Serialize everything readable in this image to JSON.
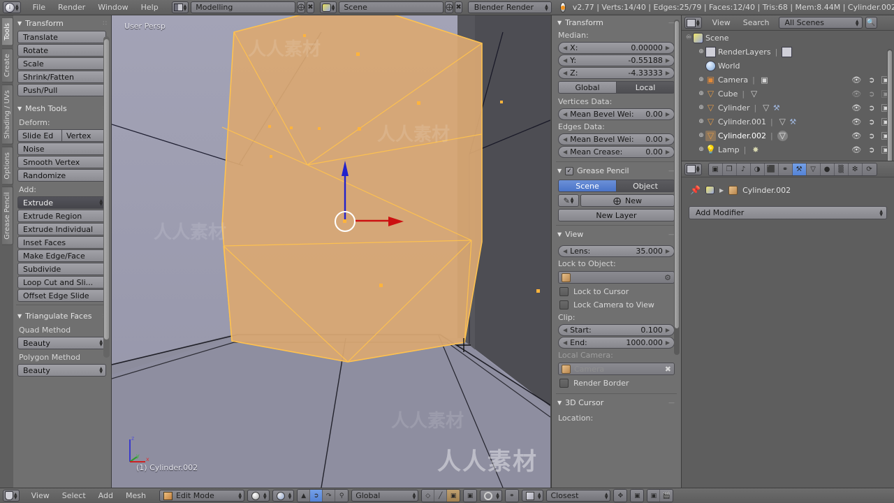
{
  "app": {
    "version": "v2.77",
    "engine": "Blender Render",
    "screen_layout": "Modelling",
    "scene_name": "Scene",
    "stats": "v2.77 | Verts:14/40 | Edges:25/79 | Faces:12/40 | Tris:68 | Mem:8.44M | Cylinder.002"
  },
  "topbar": {
    "menus": [
      "File",
      "Render",
      "Window",
      "Help"
    ],
    "layout_field": "Modelling",
    "scene_field": "Scene",
    "engine_field": "Blender Render",
    "icons": {
      "blender": "blender-icon",
      "layout": "screen-layout-icon",
      "scene": "scene-icon",
      "add": "plus-icon",
      "remove": "x-icon",
      "render_engine": "render-engine-icon"
    }
  },
  "viewport": {
    "view_label": "User Persp",
    "object_label": "(1) Cylinder.002",
    "axis": {
      "x": "x",
      "y": "y",
      "z": "z"
    },
    "watermark": "人人素材",
    "colors": {
      "bg_left": "#9a9aae",
      "bg_right": "#4f4f55",
      "floor": "#8c8c9c",
      "mesh_face": "#d9a873",
      "mesh_edge": "#ffc04d",
      "gizmo_z": "#2020dd",
      "gizmo_x": "#cc1111"
    }
  },
  "toolshelf": {
    "tabs": [
      "Tools",
      "Create",
      "Shading / UVs",
      "Options",
      "Grease Pencil"
    ],
    "active_tab": "Tools",
    "panels": [
      {
        "title": "Transform",
        "buttons": [
          "Translate",
          "Rotate",
          "Scale",
          "Shrink/Fatten",
          "Push/Pull"
        ]
      },
      {
        "title": "Mesh Tools",
        "deform_label": "Deform:",
        "deform_pair": [
          "Slide Ed",
          "Vertex"
        ],
        "deform_buttons": [
          "Noise",
          "Smooth Vertex",
          "Randomize"
        ],
        "add_label": "Add:",
        "add_dropdown": "Extrude",
        "add_buttons": [
          "Extrude Region",
          "Extrude Individual",
          "Inset Faces",
          "Make Edge/Face",
          "Subdivide",
          "Loop Cut and Sli...",
          "Offset Edge Slide"
        ]
      },
      {
        "title": "Triangulate Faces",
        "quad_label": "Quad Method",
        "quad_value": "Beauty",
        "poly_label": "Polygon Method",
        "poly_value": "Beauty"
      }
    ]
  },
  "npanel": {
    "transform": {
      "title": "Transform",
      "median_label": "Median:",
      "fields": [
        {
          "name": "X:",
          "value": "0.00000"
        },
        {
          "name": "Y:",
          "value": "-0.55188"
        },
        {
          "name": "Z:",
          "value": "-4.33333"
        }
      ],
      "space_buttons": [
        "Global",
        "Local"
      ],
      "space_active": "Global",
      "vertices_label": "Vertices Data:",
      "vertices_fields": [
        {
          "name": "Mean Bevel Wei:",
          "value": "0.00"
        }
      ],
      "edges_label": "Edges Data:",
      "edges_fields": [
        {
          "name": "Mean Bevel Wei:",
          "value": "0.00"
        },
        {
          "name": "Mean Crease:",
          "value": "0.00"
        }
      ]
    },
    "grease_pencil": {
      "title": "Grease Pencil",
      "checked": true,
      "mode_buttons": [
        "Scene",
        "Object"
      ],
      "mode_active": "Scene",
      "new_button": "New",
      "new_layer_button": "New Layer"
    },
    "view": {
      "title": "View",
      "lens_name": "Lens:",
      "lens_value": "35.000",
      "lock_object_label": "Lock to Object:",
      "lock_object_value": "",
      "lock_to_cursor": "Lock to Cursor",
      "lock_camera_to_view": "Lock Camera to View",
      "clip_label": "Clip:",
      "clip_start_name": "Start:",
      "clip_start_value": "0.100",
      "clip_end_name": "End:",
      "clip_end_value": "1000.000",
      "local_camera_label": "Local Camera:",
      "local_camera_value": "Camera",
      "render_border": "Render Border"
    },
    "cursor": {
      "title": "3D Cursor",
      "location_label": "Location:"
    }
  },
  "outliner": {
    "header": {
      "view": "View",
      "search": "Search",
      "display_mode": "All Scenes",
      "icons": {
        "mode": "outliner-display-icon",
        "filter": "search-glass-icon"
      }
    },
    "rows": [
      {
        "label": "Scene",
        "depth": 0,
        "icon": "scene-icon",
        "expander": "minus",
        "selected": false,
        "cols": false
      },
      {
        "label": "RenderLayers",
        "depth": 1,
        "icon": "renderlayer-icon",
        "expander": "plus",
        "selected": false,
        "cols": false
      },
      {
        "label": "World",
        "depth": 1,
        "icon": "world-icon",
        "expander": "none",
        "selected": false,
        "cols": false
      },
      {
        "label": "Camera",
        "depth": 1,
        "icon": "camera-icon",
        "expander": "plus",
        "selected": false,
        "cols": true
      },
      {
        "label": "Cube",
        "depth": 1,
        "icon": "mesh-icon",
        "expander": "plus",
        "selected": false,
        "cols": true,
        "dim": true
      },
      {
        "label": "Cylinder",
        "depth": 1,
        "icon": "mesh-icon",
        "expander": "plus",
        "selected": false,
        "cols": true,
        "wrench": true
      },
      {
        "label": "Cylinder.001",
        "depth": 1,
        "icon": "mesh-icon",
        "expander": "plus",
        "selected": false,
        "cols": true,
        "wrench": true
      },
      {
        "label": "Cylinder.002",
        "depth": 1,
        "icon": "mesh-icon",
        "expander": "plus",
        "selected": true,
        "cols": true
      },
      {
        "label": "Lamp",
        "depth": 1,
        "icon": "lamp-icon",
        "expander": "plus",
        "selected": false,
        "cols": true
      }
    ],
    "col_icons": [
      "eye-icon",
      "cursor-arrow-icon",
      "camera-render-icon"
    ]
  },
  "properties": {
    "tabs": [
      {
        "name": "render-tab",
        "glyph": "▣",
        "active": false
      },
      {
        "name": "renderlayer-tab",
        "glyph": "❐",
        "active": false
      },
      {
        "name": "scene-tab",
        "glyph": "♪",
        "active": false
      },
      {
        "name": "world-tab",
        "glyph": "◑",
        "active": false
      },
      {
        "name": "object-tab",
        "glyph": "⬛",
        "active": false
      },
      {
        "name": "constraint-tab",
        "glyph": "⚭",
        "active": false
      },
      {
        "name": "modifier-tab",
        "glyph": "⚒",
        "active": true
      },
      {
        "name": "data-tab",
        "glyph": "▽",
        "active": false
      },
      {
        "name": "material-tab",
        "glyph": "●",
        "active": false
      },
      {
        "name": "texture-tab",
        "glyph": "▒",
        "active": false
      },
      {
        "name": "particles-tab",
        "glyph": "❇",
        "active": false
      },
      {
        "name": "physics-tab",
        "glyph": "⟳",
        "active": false
      }
    ],
    "breadcrumb_object": "Cylinder.002",
    "add_modifier": "Add Modifier"
  },
  "viewport_header": {
    "menus": [
      "View",
      "Select",
      "Add",
      "Mesh"
    ],
    "mode": "Edit Mode",
    "transform_orientation": "Global",
    "snap_mode": "Closest",
    "icons": {
      "editor_type": "editor-type-icon",
      "mode_icon": "edit-mode-icon",
      "shading": "shading-solid-icon",
      "select_vertex": "vertex-select-icon",
      "select_edge": "edge-select-icon",
      "select_face": "face-select-icon",
      "pivot": "pivot-icon",
      "snap_magnet": "magnet-icon",
      "proportional": "proportional-edit-icon",
      "manipulator": "manipulator-icon"
    }
  }
}
